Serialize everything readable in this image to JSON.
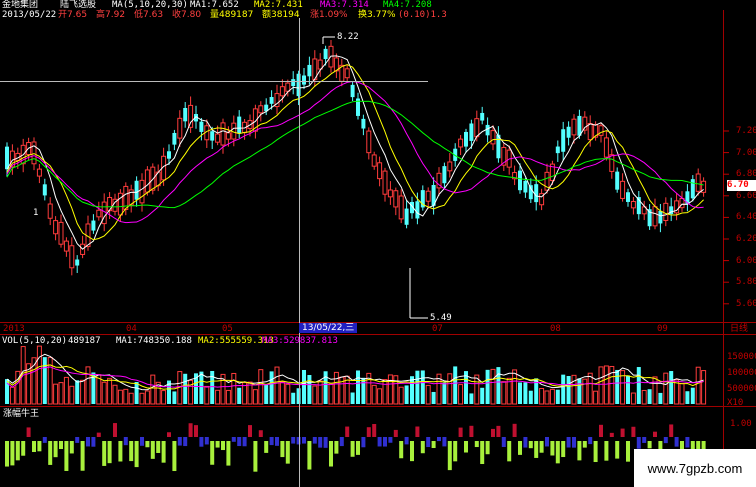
{
  "header": {
    "stock_name": "金地集团",
    "period_label": "陆飞选股",
    "ma_params": "MA(5,10,20,30)",
    "ma1": "MA1:7.652",
    "ma2": "MA2:7.431",
    "ma3": "MA3:7.314",
    "ma4": "MA4:7.208",
    "date": "2013/05/22",
    "open": "开7.65",
    "high": "高7.92",
    "low": "低7.63",
    "close": "收7.80",
    "volume": "量489187",
    "amount": "额38194",
    "change": "涨1.09%",
    "turnover": "换3.77%",
    "extra": "(0.10)1.3"
  },
  "price_chart": {
    "y_ticks": [
      "7.20",
      "7.00",
      "6.80",
      "6.60",
      "6.40",
      "6.20",
      "6.00",
      "5.80",
      "5.60"
    ],
    "current_price": "6.70",
    "high_marker": "8.22",
    "low_marker": "5.49",
    "left_marker": "1"
  },
  "time_axis": {
    "labels": [
      "2013",
      "04",
      "05",
      "07",
      "08",
      "09"
    ],
    "cursor_label": "13/05/22,三",
    "period_button": "日线"
  },
  "volume_panel": {
    "label": "VOL(5,10,20)",
    "value": "489187",
    "ma1": "MA1:748350.188",
    "ma2": "MA2:555559.313",
    "ma3": "MA3:529837.813",
    "y_ticks": [
      "150000",
      "100000",
      "500000"
    ],
    "unit": "X10"
  },
  "indicator_panel": {
    "title": "涨幅牛王",
    "y_tick": "1.00"
  },
  "watermark": "www.7gpzb.com",
  "colors": {
    "up": "#ff3c3c",
    "down": "#54ffff",
    "ma_white": "#ffffff",
    "ma_yellow": "#ffff00",
    "ma_magenta": "#ff00ff",
    "ma_green": "#00ff00",
    "axis": "#c00000"
  }
}
